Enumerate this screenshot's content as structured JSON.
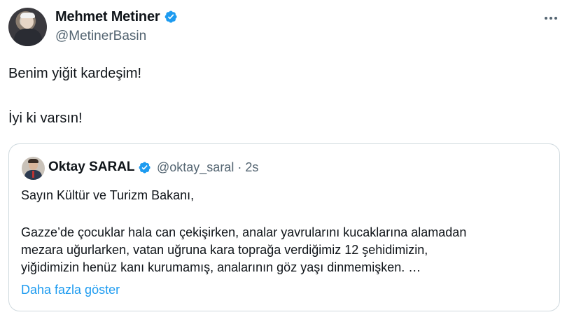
{
  "author": {
    "name": "Mehmet Metiner",
    "handle": "@MetinerBasin",
    "verified": true
  },
  "tweet": {
    "lines": [
      "Benim yiğit kardeşim!",
      "İyi ki varsın!"
    ]
  },
  "quoted": {
    "name": "Oktay SARAL",
    "handle_time": "@oktay_saral · 2s",
    "verified": true,
    "lines": [
      "Sayın Kültür ve Turizm Bakanı,",
      "Gazze’de çocuklar hala can çekişirken, analar yavrularını kucaklarına alamadan",
      "mezara uğurlarken, vatan uğruna kara toprağa verdiğimiz 12 şehidimizin,",
      "yiğidimizin henüz kanı kurumamış, analarının göz yaşı dinmemişken. …"
    ],
    "show_more": "Daha fazla göster"
  },
  "colors": {
    "verified": "#1d9bf0",
    "link": "#1d9bf0",
    "secondary_text": "#536471",
    "border": "#cfd9de"
  },
  "icons": {
    "verified": "verified-badge-icon",
    "more": "more-options-icon"
  }
}
